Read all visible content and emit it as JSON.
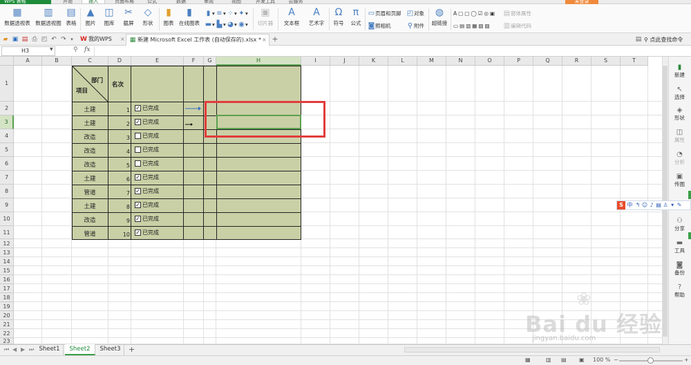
{
  "app": {
    "brand": "WPS 表格",
    "menu_tabs": [
      "开始",
      "插入",
      "页面布局",
      "公式",
      "数据",
      "审阅",
      "视图",
      "开发工具",
      "云服务"
    ],
    "login": "未登录"
  },
  "ribbon": {
    "pivot_table": "数据透视表",
    "pivot_chart": "数据透视图",
    "table": "表格",
    "picture": "图片",
    "gallery": "图库",
    "screenshot": "截屏",
    "shapes": "形状",
    "chart": "图表",
    "online_chart": "在线图表",
    "slicer": "切片器",
    "textbox": "文本框",
    "wordart": "艺术字",
    "symbol": "符号",
    "formula": "公式",
    "header_footer": "页眉和页脚",
    "object": "对象",
    "camera": "照相机",
    "attachment": "附件",
    "hyperlink": "超链接",
    "form_props": "窗体属性",
    "edit_code": "编辑代码"
  },
  "doctabs": {
    "wps": "我的WPS",
    "file": "新建 Microsoft Excel 工作表 (自动保存的).xlsx *"
  },
  "search_help": "点此查找命令",
  "formula_bar": {
    "name_box": "H3",
    "fx": "fx",
    "value": ""
  },
  "columns": [
    "A",
    "B",
    "C",
    "D",
    "E",
    "F",
    "G",
    "H",
    "I",
    "J",
    "K",
    "L",
    "M",
    "N",
    "O",
    "P",
    "Q",
    "R",
    "S",
    "T"
  ],
  "rows": [
    "1",
    "2",
    "3",
    "4",
    "5",
    "6",
    "7",
    "8",
    "9",
    "10",
    "11",
    "12",
    "13",
    "14",
    "15",
    "16",
    "17",
    "18",
    "19",
    "20",
    "21",
    "22",
    "23"
  ],
  "selected_cell": "H3",
  "table": {
    "header_dept": "部门",
    "header_item": "项目",
    "header_rank": "名次",
    "done_label": "已完成",
    "rows": [
      {
        "dept": "土建",
        "rank": "1",
        "checked": true
      },
      {
        "dept": "土建",
        "rank": "2",
        "checked": true
      },
      {
        "dept": "改造",
        "rank": "3",
        "checked": false
      },
      {
        "dept": "改造",
        "rank": "4",
        "checked": false
      },
      {
        "dept": "改造",
        "rank": "5",
        "checked": false
      },
      {
        "dept": "土建",
        "rank": "6",
        "checked": true
      },
      {
        "dept": "管道",
        "rank": "7",
        "checked": true
      },
      {
        "dept": "土建",
        "rank": "8",
        "checked": true
      },
      {
        "dept": "改造",
        "rank": "9",
        "checked": true
      },
      {
        "dept": "管道",
        "rank": "10",
        "checked": true
      }
    ]
  },
  "right_panel": [
    "新建",
    "选择",
    "形状",
    "属性",
    "分析",
    "传图",
    "分享",
    "工具",
    "备份",
    "帮助"
  ],
  "ime": {
    "logo": "S",
    "mode": "中"
  },
  "sheets": [
    "Sheet1",
    "Sheet2",
    "Sheet3"
  ],
  "active_sheet": "Sheet2",
  "status": {
    "zoom": "100 %"
  },
  "watermark": {
    "main": "Bai du 经验",
    "sub": "jingyan.baidu.com"
  },
  "colors": {
    "table_fill": "#cad0a6",
    "selection": "#5aa050",
    "annotation": "#e23c3c",
    "brand": "#1e8c3a"
  }
}
